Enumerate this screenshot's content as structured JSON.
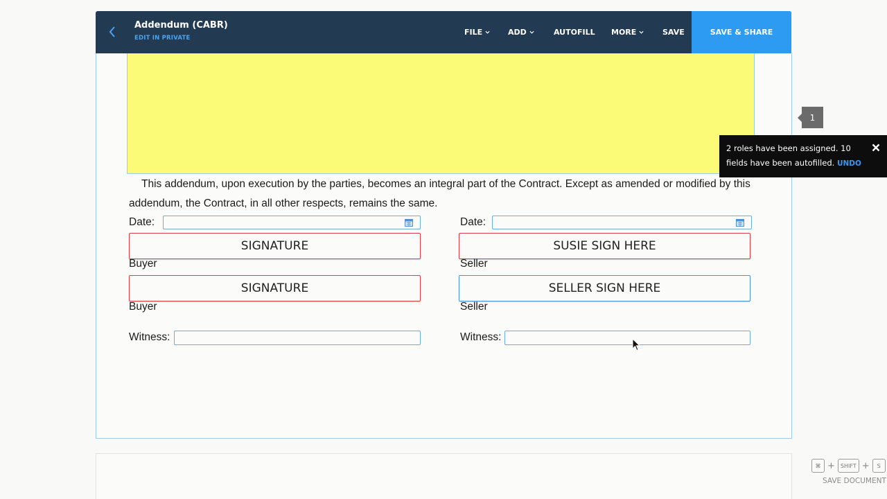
{
  "header": {
    "title": "Addendum (CABR)",
    "subtitle": "EDIT IN PRIVATE",
    "menu": {
      "file": "FILE",
      "add": "ADD",
      "autofill": "AUTOFILL",
      "more": "MORE",
      "save": "SAVE",
      "save_share": "SAVE & SHARE"
    }
  },
  "document": {
    "paragraph": "This addendum, upon execution by the parties, becomes an integral part of the Contract. Except as amended or modified by this addendum, the Contract, in all other respects, remains the same.",
    "date_label": "Date:",
    "witness_label": "Witness:",
    "left": {
      "sig1": "SIGNATURE",
      "role1": "Buyer",
      "sig2": "SIGNATURE",
      "role2": "Buyer"
    },
    "right": {
      "sig1": "SUSIE SIGN HERE",
      "role1": "Seller",
      "sig2": "SELLER SIGN HERE",
      "role2": "Seller"
    }
  },
  "page_badge": "1",
  "toast": {
    "message": "2 roles have been assigned. 10 fields have been autofilled.",
    "undo": "UNDO"
  },
  "shortcut": {
    "keys": [
      "⌘",
      "SHIFT",
      "S"
    ],
    "label": "SAVE DOCUMENT"
  },
  "colors": {
    "header_bg": "#233b52",
    "accent": "#2e9bf2",
    "highlight": "#fbfb78",
    "required_border": "#d8404a"
  }
}
